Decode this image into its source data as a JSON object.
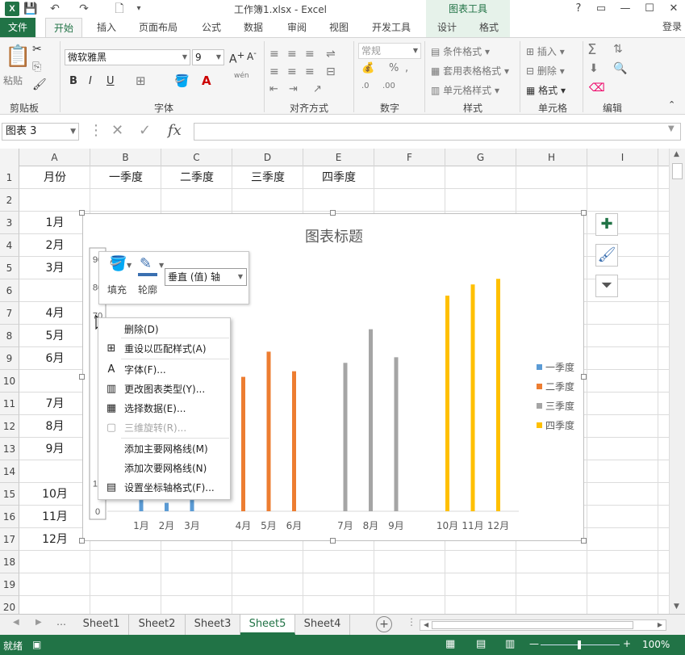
{
  "titlebar": {
    "title": "工作簿1.xlsx - Excel",
    "help": "?",
    "restore": "▭",
    "minimize": "—",
    "maximize": "☐",
    "close": "✕"
  },
  "ribbon_tabs": {
    "file": "文件",
    "home": "开始",
    "insert": "插入",
    "page_layout": "页面布局",
    "formulas": "公式",
    "data": "数据",
    "review": "审阅",
    "view": "视图",
    "developer": "开发工具",
    "chart_tools": "图表工具",
    "design": "设计",
    "format": "格式",
    "login": "登录"
  },
  "ribbon": {
    "paste": "粘贴",
    "clipboard": "剪贴板",
    "font_name": "微软雅黑",
    "font_size": "9",
    "font_group": "字体",
    "bold": "B",
    "italic": "I",
    "underline": "U",
    "align_group": "对齐方式",
    "number_format": "常规",
    "number_group": "数字",
    "cond_format": "条件格式",
    "table_format": "套用表格格式",
    "cell_style": "单元格样式",
    "style_group": "样式",
    "insert": "插入",
    "delete": "删除",
    "format": "格式",
    "cells_group": "单元格",
    "edit_group": "编辑"
  },
  "formula_bar": {
    "name_box": "图表 3",
    "fx": "fx",
    "value": ""
  },
  "columns": [
    "A",
    "B",
    "C",
    "D",
    "E",
    "F",
    "G",
    "H",
    "I"
  ],
  "rows": [
    "1",
    "2",
    "3",
    "4",
    "5",
    "6",
    "7",
    "8",
    "9",
    "10",
    "11",
    "12",
    "13",
    "14",
    "15",
    "16",
    "17",
    "18",
    "19",
    "20"
  ],
  "cells": {
    "A1": "月份",
    "B1": "一季度",
    "C1": "二季度",
    "D1": "三季度",
    "E1": "四季度",
    "A3": "1月",
    "A4": "2月",
    "A5": "3月",
    "A7": "4月",
    "A8": "5月",
    "A9": "6月",
    "A11": "7月",
    "A12": "8月",
    "A13": "9月",
    "A15": "10月",
    "A16": "11月",
    "A17": "12月"
  },
  "chart": {
    "title": "图表标题",
    "colors": {
      "q1": "#5b9bd5",
      "q2": "#ed7d31",
      "q3": "#a5a5a5",
      "q4": "#ffc000"
    }
  },
  "chart_data": {
    "type": "bar",
    "title": "图表标题",
    "ylim": [
      0,
      90
    ],
    "y_ticks": [
      "0",
      "10",
      "70",
      "80",
      "90"
    ],
    "categories": [
      "1月",
      "2月",
      "3月",
      "4月",
      "5月",
      "6月",
      "7月",
      "8月",
      "9月",
      "10月",
      "11月",
      "12月"
    ],
    "series": [
      {
        "name": "一季度",
        "values": [
          4,
          3,
          4,
          null,
          null,
          null,
          null,
          null,
          null,
          null,
          null,
          null
        ]
      },
      {
        "name": "二季度",
        "values": [
          null,
          null,
          null,
          48,
          57,
          50,
          null,
          null,
          null,
          null,
          null,
          null
        ]
      },
      {
        "name": "三季度",
        "values": [
          null,
          null,
          null,
          null,
          null,
          null,
          53,
          65,
          55,
          null,
          null,
          null
        ]
      },
      {
        "name": "四季度",
        "values": [
          null,
          null,
          null,
          null,
          null,
          null,
          null,
          null,
          null,
          77,
          81,
          83
        ]
      }
    ],
    "legend": "right"
  },
  "mini_toolbar": {
    "fill": "填充",
    "outline": "轮廓",
    "element": "垂直 (值) 轴"
  },
  "context_menu": [
    {
      "label": "删除(D)",
      "icon": "",
      "enabled": true
    },
    {
      "label": "重设以匹配样式(A)",
      "icon": "⊞",
      "enabled": true
    },
    {
      "label": "字体(F)...",
      "icon": "A",
      "enabled": true
    },
    {
      "label": "更改图表类型(Y)...",
      "icon": "▥",
      "enabled": true
    },
    {
      "label": "选择数据(E)...",
      "icon": "▦",
      "enabled": true
    },
    {
      "label": "三维旋转(R)...",
      "icon": "▢",
      "enabled": false
    },
    {
      "label": "添加主要网格线(M)",
      "icon": "",
      "enabled": true
    },
    {
      "label": "添加次要网格线(N)",
      "icon": "",
      "enabled": true
    },
    {
      "label": "设置坐标轴格式(F)...",
      "icon": "▤",
      "enabled": true
    }
  ],
  "sheets": [
    "Sheet1",
    "Sheet2",
    "Sheet3",
    "Sheet5",
    "Sheet4"
  ],
  "active_sheet": "Sheet5",
  "status": {
    "ready": "就绪",
    "zoom": "100%"
  }
}
